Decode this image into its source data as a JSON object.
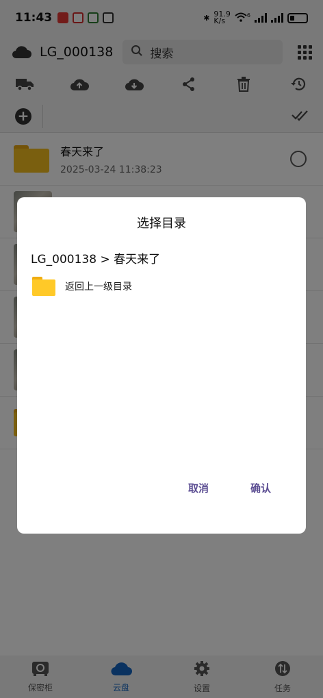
{
  "status_bar": {
    "time": "11:43",
    "net_speed_top": "91.9",
    "net_speed_bottom": "K/s",
    "wifi_label": "6"
  },
  "app_bar": {
    "title": "LG_000138",
    "search_placeholder": "搜索"
  },
  "toolbar": {
    "icons": [
      "truck-icon",
      "cloud-upload-icon",
      "cloud-download-icon",
      "share-icon",
      "trash-icon",
      "history-icon"
    ]
  },
  "list": {
    "folder_row": {
      "name": "春天来了",
      "date": "2025-03-24 11:38:23"
    }
  },
  "bottom_nav": {
    "items": [
      {
        "label": "保密柜",
        "icon": "safe-icon"
      },
      {
        "label": "云盘",
        "icon": "cloud-icon",
        "active": true
      },
      {
        "label": "设置",
        "icon": "gear-icon"
      },
      {
        "label": "任务",
        "icon": "transfer-icon"
      }
    ]
  },
  "dialog": {
    "title": "选择目录",
    "path": "LG_000138 > 春天来了",
    "up_label": "返回上一级目录",
    "cancel_label": "取消",
    "confirm_label": "确认"
  },
  "colors": {
    "accent": "#5b4d92",
    "nav_active": "#1565c0",
    "folder": "#f5be1f"
  }
}
